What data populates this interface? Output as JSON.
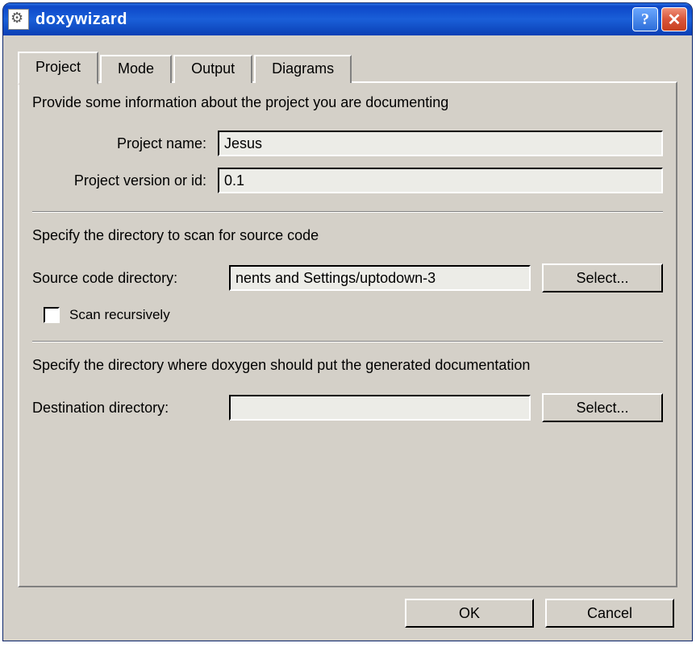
{
  "window": {
    "title": "doxywizard"
  },
  "tabs": [
    {
      "label": "Project",
      "active": true
    },
    {
      "label": "Mode",
      "active": false
    },
    {
      "label": "Output",
      "active": false
    },
    {
      "label": "Diagrams",
      "active": false
    }
  ],
  "project": {
    "section1_desc": "Provide some information about the project you are documenting",
    "name_label": "Project name:",
    "name_value": "Jesus",
    "version_label": "Project version or id:",
    "version_value": "0.1",
    "section2_desc": "Specify the directory to scan for source code",
    "srcdir_label": "Source code directory:",
    "srcdir_value": "nents and Settings/uptodown-3",
    "select_label": "Select...",
    "scan_recursive_label": "Scan recursively",
    "scan_recursive_checked": false,
    "section3_desc": "Specify the directory where doxygen should put the generated documentation",
    "destdir_label": "Destination directory:",
    "destdir_value": ""
  },
  "buttons": {
    "ok": "OK",
    "cancel": "Cancel"
  }
}
